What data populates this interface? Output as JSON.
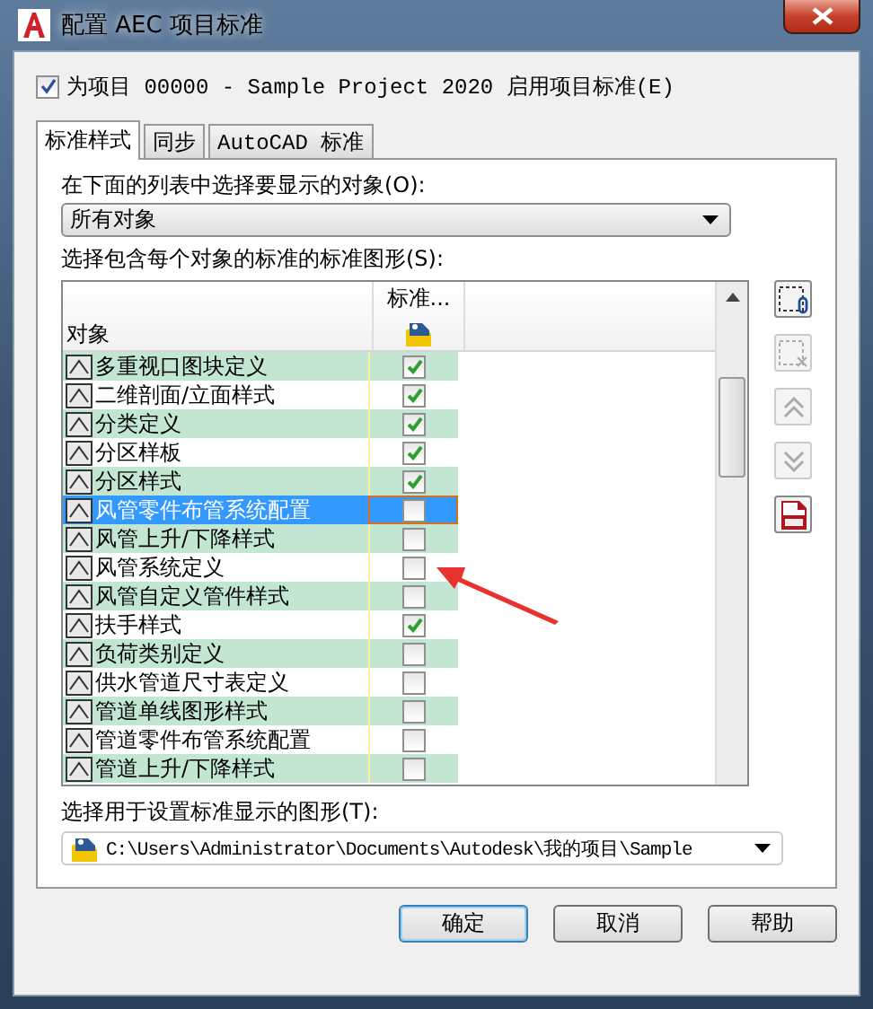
{
  "window": {
    "title": "配置 AEC 项目标准"
  },
  "enable": {
    "label": "为项目 00000 - Sample Project 2020 启用项目标准(E)",
    "checked": true
  },
  "tabs": [
    {
      "label": "标准样式",
      "selected": true
    },
    {
      "label": "同步",
      "selected": false
    },
    {
      "label": "AutoCAD 标准",
      "selected": false
    }
  ],
  "object_filter": {
    "label": "在下面的列表中选择要显示的对象(O):",
    "value": "所有对象"
  },
  "list_label": "选择包含每个对象的标准的标准图形(S):",
  "table": {
    "columns": [
      "对象",
      "标准..."
    ],
    "rows": [
      {
        "name": "多重视口图块定义",
        "checked": true,
        "selected": false
      },
      {
        "name": "二维剖面/立面样式",
        "checked": true,
        "selected": false
      },
      {
        "name": "分类定义",
        "checked": true,
        "selected": false
      },
      {
        "name": "分区样板",
        "checked": true,
        "selected": false
      },
      {
        "name": "分区样式",
        "checked": true,
        "selected": false
      },
      {
        "name": "风管零件布管系统配置",
        "checked": false,
        "selected": true
      },
      {
        "name": "风管上升/下降样式",
        "checked": false,
        "selected": false
      },
      {
        "name": "风管系统定义",
        "checked": false,
        "selected": false
      },
      {
        "name": "风管自定义管件样式",
        "checked": false,
        "selected": false
      },
      {
        "name": "扶手样式",
        "checked": true,
        "selected": false
      },
      {
        "name": "负荷类别定义",
        "checked": false,
        "selected": false
      },
      {
        "name": "供水管道尺寸表定义",
        "checked": false,
        "selected": false
      },
      {
        "name": "管道单线图形样式",
        "checked": false,
        "selected": false
      },
      {
        "name": "管道零件布管系统配置",
        "checked": false,
        "selected": false
      },
      {
        "name": "管道上升/下降样式",
        "checked": false,
        "selected": false
      }
    ]
  },
  "side_tools": [
    {
      "kind": "attach",
      "disabled": false
    },
    {
      "kind": "remove",
      "disabled": true
    },
    {
      "kind": "up",
      "disabled": true
    },
    {
      "kind": "down",
      "disabled": true
    },
    {
      "kind": "export",
      "disabled": false
    }
  ],
  "display_drawing": {
    "label": "选择用于设置标准显示的图形(T):",
    "value": "C:\\Users\\Administrator\\Documents\\Autodesk\\我的项目\\Sample"
  },
  "buttons": [
    {
      "label": "确定",
      "default": true
    },
    {
      "label": "取消",
      "default": false
    },
    {
      "label": "帮助",
      "default": false
    }
  ]
}
